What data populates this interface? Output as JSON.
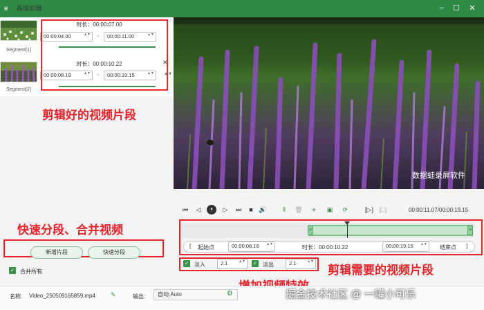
{
  "window": {
    "title": "高级剪辑",
    "logo_glyph": "ʁ",
    "minimize_glyph": "−",
    "maximize_glyph": "☐",
    "close_glyph": "✕"
  },
  "segments": [
    {
      "label": "Segment[1]",
      "duration": "时长：00:00:07.00",
      "start": "00:00:04.00",
      "end": "00:00:11.00"
    },
    {
      "label": "Segment[2]",
      "duration": "时长：00:00:10.22",
      "start": "00:00:08.18",
      "end": "00:00:19.15"
    }
  ],
  "segment_separator": "~",
  "spin_glyph": "▲▼",
  "delete_glyph": "✕",
  "annotations": {
    "segments": "剪辑好的视频片段",
    "split_merge": "快速分段、合并视频",
    "clip": "剪辑需要的视频片段",
    "effects": "增加视频特效",
    "watermark_video": "数据蛙录屏软件",
    "watermark_footer": "掘金技术社区 @ 一罐小可乐"
  },
  "left_buttons": {
    "add_segment": "新增片段",
    "quick_split": "快速分段",
    "merge_all": "合并所有",
    "check_glyph": "✓"
  },
  "player": {
    "time": "00:00:11.07/00:00:19.15",
    "icons": [
      "⏮",
      "◁",
      "⏸",
      "▷",
      "⏭",
      "■",
      "🔊",
      "⫴",
      "🗑",
      "+",
      "▣",
      "⟳",
      "[▷]",
      "[□]"
    ]
  },
  "clip_bar": {
    "start_label": "起始点",
    "start_value": "00:00:08.18",
    "duration": "时长：00:00:10.22",
    "end_value": "00:00:19.15",
    "end_label": "结束点",
    "bracket_open": "[",
    "bracket_close": "]",
    "handle_glyph": "≡"
  },
  "effects": {
    "fade_in_label": "淡入",
    "fade_in_value": "2.1",
    "fade_out_label": "淡出",
    "fade_out_value": "2.1"
  },
  "footer": {
    "name_label": "名称:",
    "name_value": "Video_250509165859.mp4",
    "output_label": "输出:",
    "output_value": "自动:Auto",
    "edit_glyph": "✎",
    "gear_glyph": "⚙"
  },
  "colors": {
    "title_bar": "#2e8b45",
    "accent_green": "#3a8f4a",
    "annotation_red": "#e4262c"
  }
}
